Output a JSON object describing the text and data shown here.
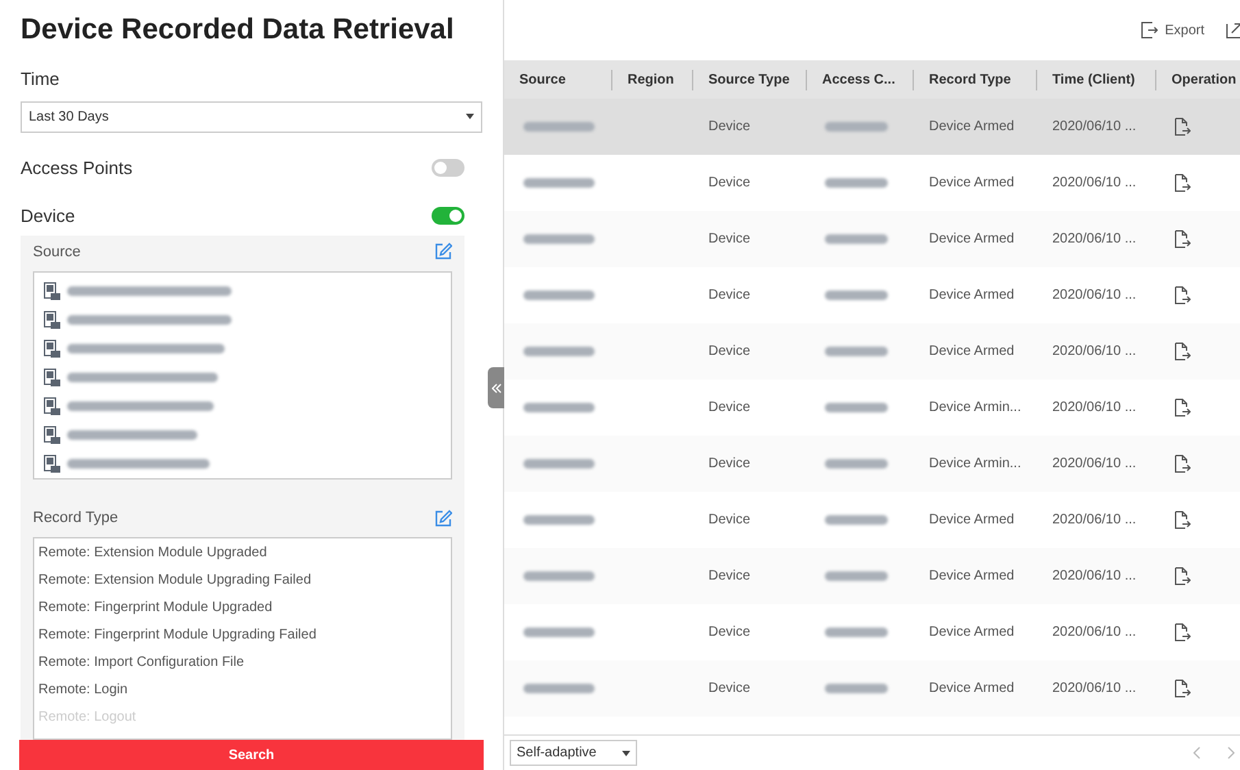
{
  "title": "Device Recorded Data Retrieval",
  "time": {
    "label": "Time",
    "value": "Last 30 Days"
  },
  "toggles": [
    {
      "label": "Access Points",
      "on": false
    },
    {
      "label": "Device",
      "on": true
    }
  ],
  "source": {
    "label": "Source"
  },
  "record_type": {
    "label": "Record Type",
    "items": [
      "Remote: Extension Module Upgraded",
      "Remote: Extension Module Upgrading Failed",
      "Remote: Fingerprint Module Upgraded",
      "Remote: Fingerprint Module Upgrading Failed",
      "Remote: Import Configuration File",
      "Remote: Login",
      "Remote: Logout"
    ]
  },
  "search_button": "Search",
  "toolbar": {
    "export": "Export"
  },
  "table": {
    "columns": [
      "Source",
      "Region",
      "Source Type",
      "Access C...",
      "Record Type",
      "Time (Client)",
      "Operation"
    ],
    "rows": [
      {
        "selected": true,
        "source_type": "Device",
        "record_type": "Device Armed",
        "time": "2020/06/10 ..."
      },
      {
        "selected": false,
        "source_type": "Device",
        "record_type": "Device Armed",
        "time": "2020/06/10 ..."
      },
      {
        "selected": false,
        "source_type": "Device",
        "record_type": "Device Armed",
        "time": "2020/06/10 ..."
      },
      {
        "selected": false,
        "source_type": "Device",
        "record_type": "Device Armed",
        "time": "2020/06/10 ..."
      },
      {
        "selected": false,
        "source_type": "Device",
        "record_type": "Device Armed",
        "time": "2020/06/10 ..."
      },
      {
        "selected": false,
        "source_type": "Device",
        "record_type": "Device Armin...",
        "time": "2020/06/10 ..."
      },
      {
        "selected": false,
        "source_type": "Device",
        "record_type": "Device Armin...",
        "time": "2020/06/10 ..."
      },
      {
        "selected": false,
        "source_type": "Device",
        "record_type": "Device Armed",
        "time": "2020/06/10 ..."
      },
      {
        "selected": false,
        "source_type": "Device",
        "record_type": "Device Armed",
        "time": "2020/06/10 ..."
      },
      {
        "selected": false,
        "source_type": "Device",
        "record_type": "Device Armed",
        "time": "2020/06/10 ..."
      },
      {
        "selected": false,
        "source_type": "Device",
        "record_type": "Device Armed",
        "time": "2020/06/10 ..."
      }
    ]
  },
  "page_size": "Self-adaptive"
}
